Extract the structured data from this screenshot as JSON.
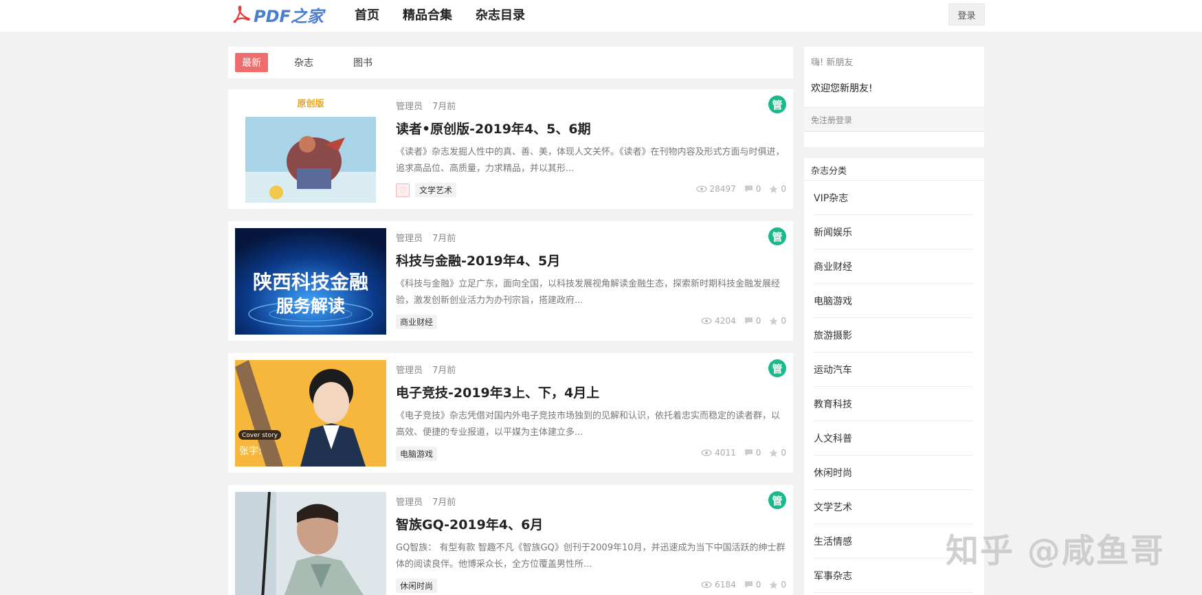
{
  "header": {
    "logo_text": "PDF之家",
    "nav": [
      "首页",
      "精品合集",
      "杂志目录"
    ],
    "login_label": "登录"
  },
  "tabs": [
    {
      "label": "最新",
      "active": true
    },
    {
      "label": "杂志",
      "active": false
    },
    {
      "label": "图书",
      "active": false
    }
  ],
  "posts": [
    {
      "author": "管理员",
      "time": "7月前",
      "title": "读者•原创版-2019年4、5、6期",
      "excerpt": "《读者》杂志发掘人性中的真、善、美，体现人文关怀。《读者》在刊物内容及形式方面与时俱进，追求高品位、高质量，力求精品，并以其形...",
      "tag": "文学艺术",
      "views": "28497",
      "comments": "0",
      "stars": "0",
      "badge": "管",
      "cover_title": "原创版",
      "has_heart": true
    },
    {
      "author": "管理员",
      "time": "7月前",
      "title": "科技与金融-2019年4、5月",
      "excerpt": "《科技与金融》立足广东，面向全国，以科技发展视角解读金融生态，探索新时期科技金融发展经验，激发创新创业活力为办刊宗旨，搭建政府...",
      "tag": "商业财经",
      "views": "4204",
      "comments": "0",
      "stars": "0",
      "badge": "管",
      "cover_line1": "陕西科技金融",
      "cover_line2": "服务解读"
    },
    {
      "author": "管理员",
      "time": "7月前",
      "title": "电子竞技-2019年3上、下，4月上",
      "excerpt": "《电子竞技》杂志凭借对国内外电子竞技市场独到的见解和认识，依托着忠实而稳定的读者群，以高效、便捷的专业报道，以平媒为主体建立多...",
      "tag": "电脑游戏",
      "views": "4011",
      "comments": "0",
      "stars": "0",
      "badge": "管",
      "cover_label": "Cover story",
      "cover_name": "张宇:"
    },
    {
      "author": "管理员",
      "time": "7月前",
      "title": "智族GQ-2019年4、6月",
      "excerpt": "GQ智族： 有型有款 智趣不凡《智族GQ》创刊于2009年10月，并迅速成为当下中国活跃的绅士群体的阅读良伴。他博采众长，全方位覆盖男性所...",
      "tag": "休闲时尚",
      "views": "6184",
      "comments": "0",
      "stars": "0",
      "badge": "管"
    }
  ],
  "sidebar": {
    "greeting": "嗨! 新朋友",
    "welcome": "欢迎您新朋友!",
    "register_link": "免注册登录",
    "categories_title": "杂志分类",
    "categories": [
      "VIP杂志",
      "新闻娱乐",
      "商业财经",
      "电脑游戏",
      "旅游摄影",
      "运动汽车",
      "教育科技",
      "人文科普",
      "休闲时尚",
      "文学艺术",
      "生活情感",
      "军事杂志"
    ]
  },
  "watermark": "知乎 @咸鱼哥",
  "colors": {
    "accent_red": "#ee6e6e",
    "badge_green": "#19b98c",
    "logo_blue": "#4a7ecf",
    "background": "#f2f2f2"
  }
}
